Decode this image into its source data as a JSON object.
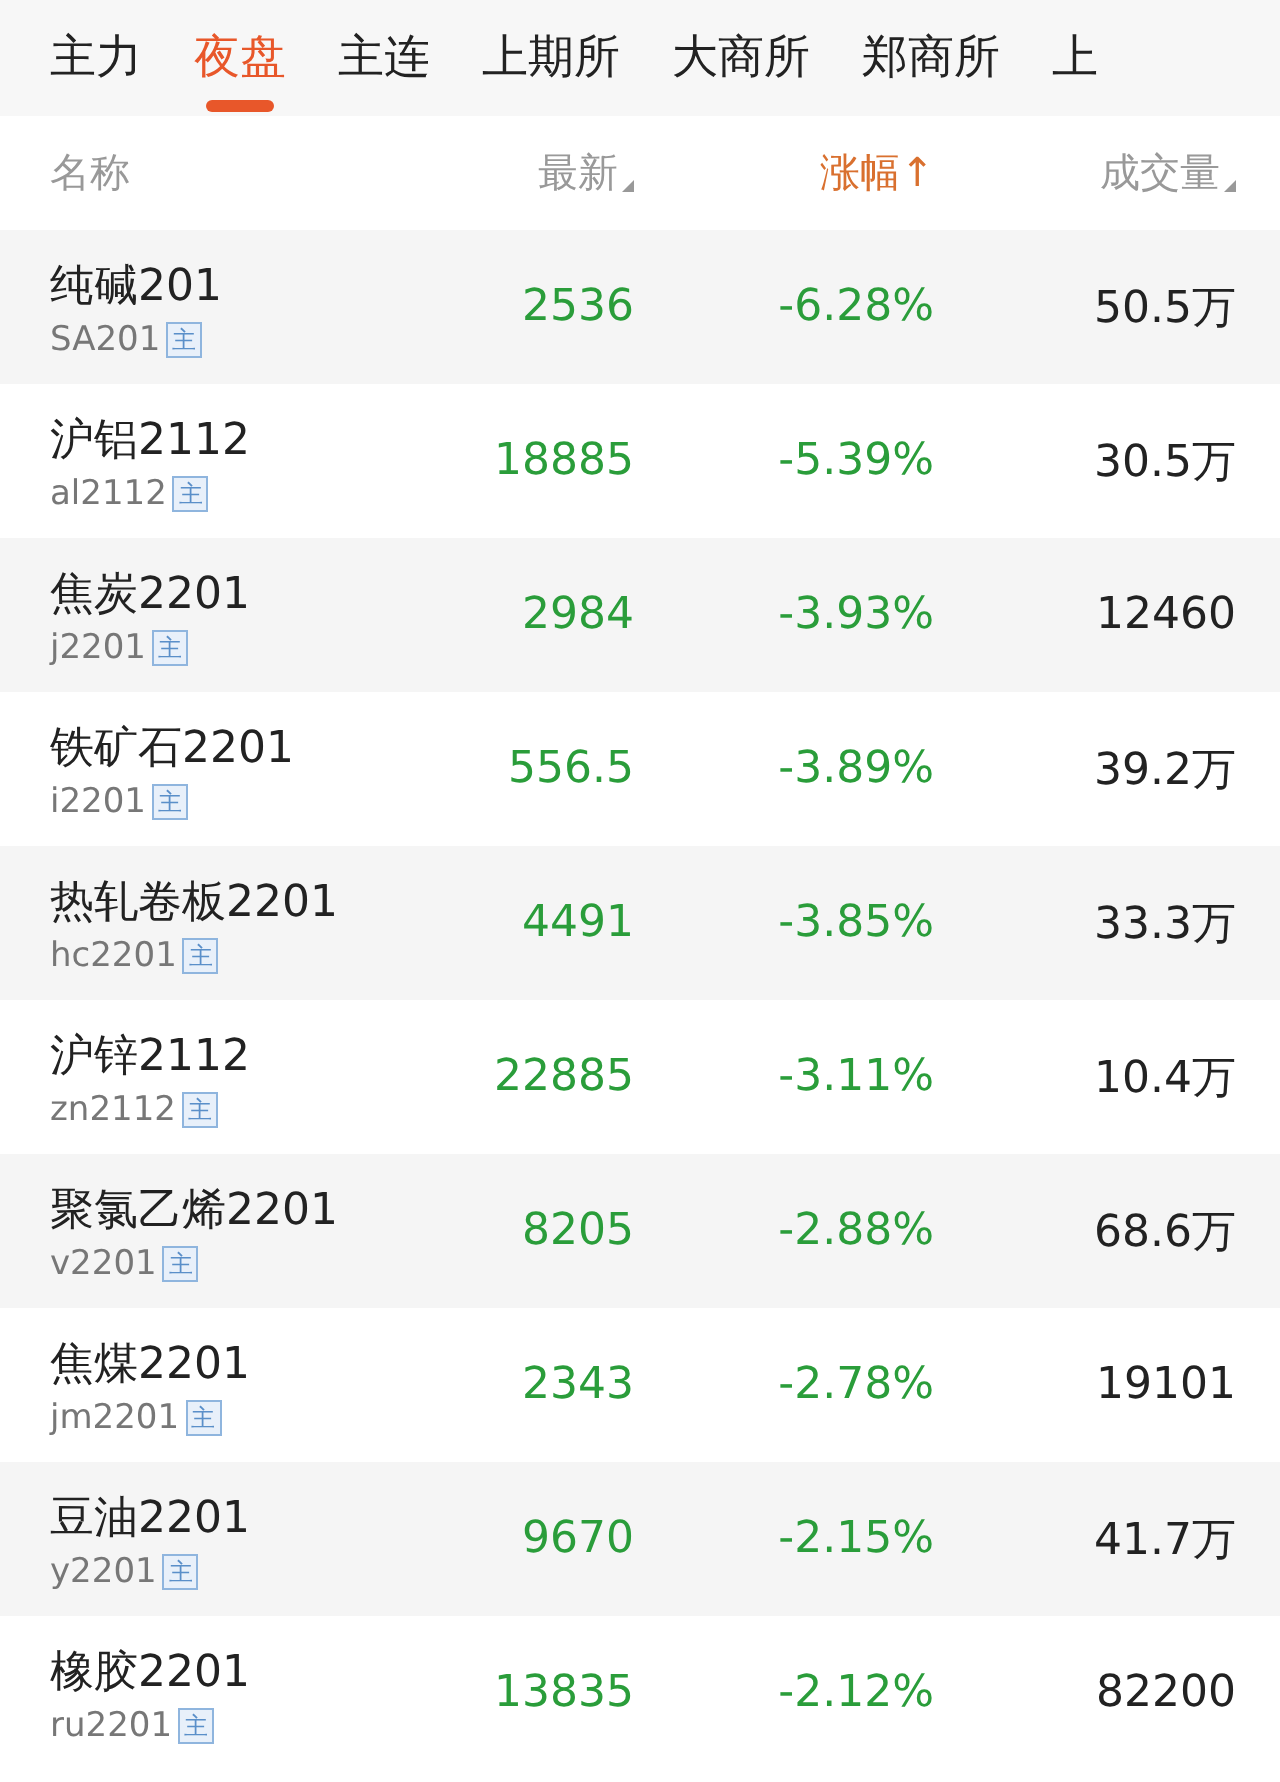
{
  "tabs": [
    {
      "label": "主力",
      "selected": false
    },
    {
      "label": "夜盘",
      "selected": true
    },
    {
      "label": "主连",
      "selected": false
    },
    {
      "label": "上期所",
      "selected": false
    },
    {
      "label": "大商所",
      "selected": false
    },
    {
      "label": "郑商所",
      "selected": false
    },
    {
      "label": "上",
      "selected": false
    }
  ],
  "table": {
    "columns": [
      {
        "label": "名称",
        "kind": "plain"
      },
      {
        "label": "最新",
        "kind": "sortable"
      },
      {
        "label": "涨幅↑",
        "kind": "active"
      },
      {
        "label": "成交量",
        "kind": "sortable"
      }
    ],
    "rows": [
      {
        "name": "纯碱201",
        "code": "SA201",
        "tag": "主",
        "price": "2536",
        "change": "-6.28%",
        "volume": "50.5万"
      },
      {
        "name": "沪铝2112",
        "code": "al2112",
        "tag": "主",
        "price": "18885",
        "change": "-5.39%",
        "volume": "30.5万"
      },
      {
        "name": "焦炭2201",
        "code": "j2201",
        "tag": "主",
        "price": "2984",
        "change": "-3.93%",
        "volume": "12460"
      },
      {
        "name": "铁矿石2201",
        "code": "i2201",
        "tag": "主",
        "price": "556.5",
        "change": "-3.89%",
        "volume": "39.2万"
      },
      {
        "name": "热轧卷板2201",
        "code": "hc2201",
        "tag": "主",
        "price": "4491",
        "change": "-3.85%",
        "volume": "33.3万"
      },
      {
        "name": "沪锌2112",
        "code": "zn2112",
        "tag": "主",
        "price": "22885",
        "change": "-3.11%",
        "volume": "10.4万"
      },
      {
        "name": "聚氯乙烯2201",
        "code": "v2201",
        "tag": "主",
        "price": "8205",
        "change": "-2.88%",
        "volume": "68.6万"
      },
      {
        "name": "焦煤2201",
        "code": "jm2201",
        "tag": "主",
        "price": "2343",
        "change": "-2.78%",
        "volume": "19101"
      },
      {
        "name": "豆油2201",
        "code": "y2201",
        "tag": "主",
        "price": "9670",
        "change": "-2.15%",
        "volume": "41.7万"
      },
      {
        "name": "橡胶2201",
        "code": "ru2201",
        "tag": "主",
        "price": "13835",
        "change": "-2.12%",
        "volume": "82200"
      }
    ]
  }
}
